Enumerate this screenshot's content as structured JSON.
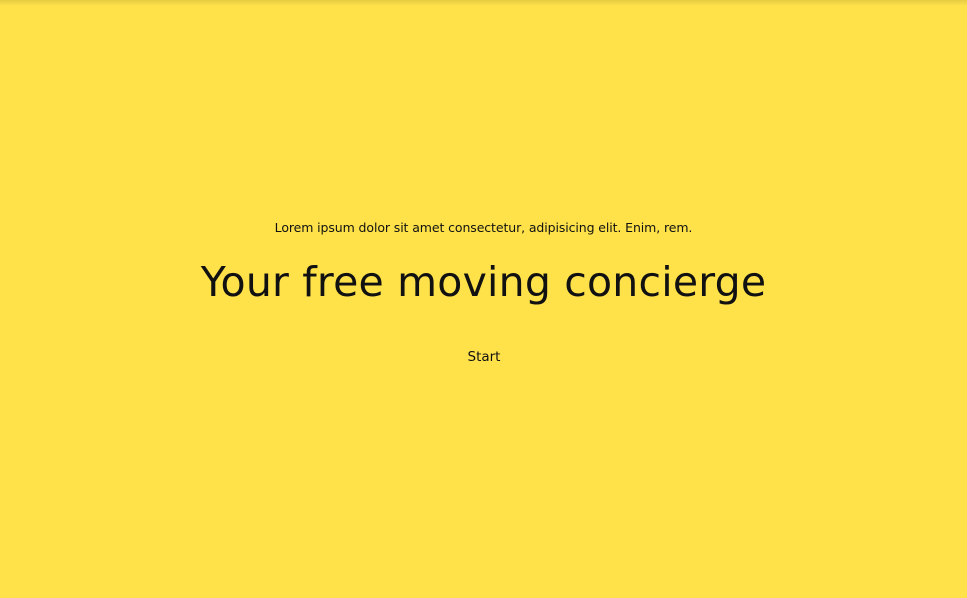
{
  "theme": {
    "background": "#FFE24A",
    "text": "#111111"
  },
  "hero": {
    "tagline": "Lorem ipsum dolor sit amet consectetur, adipisicing elit. Enim, rem.",
    "headline": "Your free moving concierge",
    "start_label": "Start"
  }
}
